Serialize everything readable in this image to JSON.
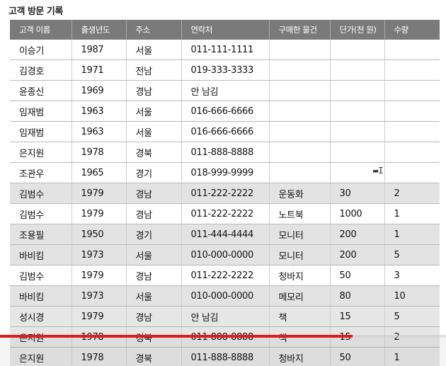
{
  "title": "고객 방문 기록",
  "table": {
    "headers": [
      "고객 이름",
      "출생년도",
      "주소",
      "연락처",
      "구매한 물건",
      "단가(천 원)",
      "수량"
    ],
    "rows": [
      [
        "이승기",
        "1987",
        "서울",
        "011-111-1111",
        "",
        "",
        ""
      ],
      [
        "김경호",
        "1971",
        "전남",
        "019-333-3333",
        "",
        "",
        ""
      ],
      [
        "윤종신",
        "1969",
        "경남",
        "안 남김",
        "",
        "",
        ""
      ],
      [
        "임재범",
        "1963",
        "서울",
        "016-666-6666",
        "",
        "",
        ""
      ],
      [
        "임재범",
        "1963",
        "서울",
        "016-666-6666",
        "",
        "",
        ""
      ],
      [
        "은지원",
        "1978",
        "경북",
        "011-888-8888",
        "",
        "",
        ""
      ],
      [
        "조관우",
        "1965",
        "경기",
        "018-999-9999",
        "",
        "",
        ""
      ],
      [
        "김범수",
        "1979",
        "경남",
        "011-222-2222",
        "운동화",
        "30",
        "2"
      ],
      [
        "김범수",
        "1979",
        "경남",
        "011-222-2222",
        "노트북",
        "1000",
        "1"
      ],
      [
        "조용필",
        "1950",
        "경기",
        "011-444-4444",
        "모니터",
        "200",
        "1"
      ],
      [
        "바비킴",
        "1973",
        "서울",
        "010-000-0000",
        "모니터",
        "200",
        "5"
      ],
      [
        "김범수",
        "1979",
        "경남",
        "011-222-2222",
        "청바지",
        "50",
        "3"
      ],
      [
        "바비킴",
        "1973",
        "서울",
        "010-000-0000",
        "메모리",
        "80",
        "10"
      ],
      [
        "성시경",
        "1979",
        "경남",
        "안 남김",
        "책",
        "15",
        "5"
      ],
      [
        "은지원",
        "1978",
        "경북",
        "011-888-8888",
        "책",
        "15",
        "2"
      ],
      [
        "은지원",
        "1978",
        "경북",
        "011-888-8888",
        "청바지",
        "50",
        "1"
      ]
    ]
  },
  "video": {
    "progress_fraction": 0.79,
    "progress_color": "#e31b1b"
  }
}
